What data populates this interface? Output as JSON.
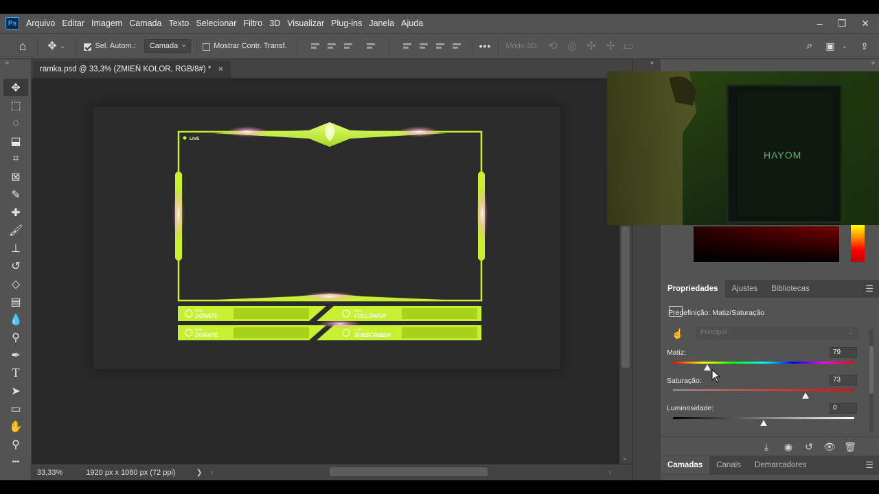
{
  "app": {
    "logo": "Ps",
    "menu": [
      "Arquivo",
      "Editar",
      "Imagem",
      "Camada",
      "Texto",
      "Selecionar",
      "Filtro",
      "3D",
      "Visualizar",
      "Plug-ins",
      "Janela",
      "Ajuda"
    ],
    "window_controls": [
      "–",
      "❐",
      "✕"
    ]
  },
  "options_bar": {
    "auto_select_label": "Sel. Autom.:",
    "auto_select_checked": true,
    "auto_select_target": "Camada",
    "show_transform_label": "Mostrar Contr. Transf.",
    "show_transform_checked": false,
    "mode3d_label": "Modo 3D:",
    "more_label": "•••"
  },
  "document": {
    "tab_title": "ramka.psd @ 33,3% (ZMIEŃ KOLOR, RGB/8#) *",
    "close_glyph": "✕",
    "overlay": {
      "live_label": "LIVE",
      "rows": [
        {
          "left_small": "NEW",
          "left_big": "DONATE",
          "right_small": "NEW",
          "right_big": "FOLLOWER"
        },
        {
          "left_small": "NEW",
          "left_big": "DONATE",
          "right_small": "LAST",
          "right_big": "SUBSCRIBER"
        }
      ],
      "accent": "#c8f030"
    }
  },
  "status_bar": {
    "zoom": "33,33%",
    "doc_info": "1920 px x 1080 px (72 ppi)",
    "arrow": "❯"
  },
  "panels": {
    "collapse_left": "«",
    "collapse_right": "»",
    "properties_tabs": [
      "Propriedades",
      "Ajustes",
      "Bibliotecas"
    ],
    "properties_active": "Propriedades",
    "preset_label": "Predefinição: Matiz/Saturação",
    "preset_value": "Principal",
    "hue": {
      "label": "Matiz:",
      "value": "79",
      "position": 0.19
    },
    "saturation": {
      "label": "Saturação:",
      "value": "73",
      "position": 0.73
    },
    "lightness": {
      "label": "Luminosidade:",
      "value": "0",
      "position": 0.5
    },
    "layer_tabs": [
      "Camadas",
      "Canais",
      "Demarcadores"
    ],
    "layer_active": "Camadas"
  },
  "webcam": {
    "brand_text": "HAYOM"
  },
  "colors": {
    "ui_bg": "#535353",
    "canvas_bg": "#282828",
    "overlay_green": "#c8f030"
  }
}
